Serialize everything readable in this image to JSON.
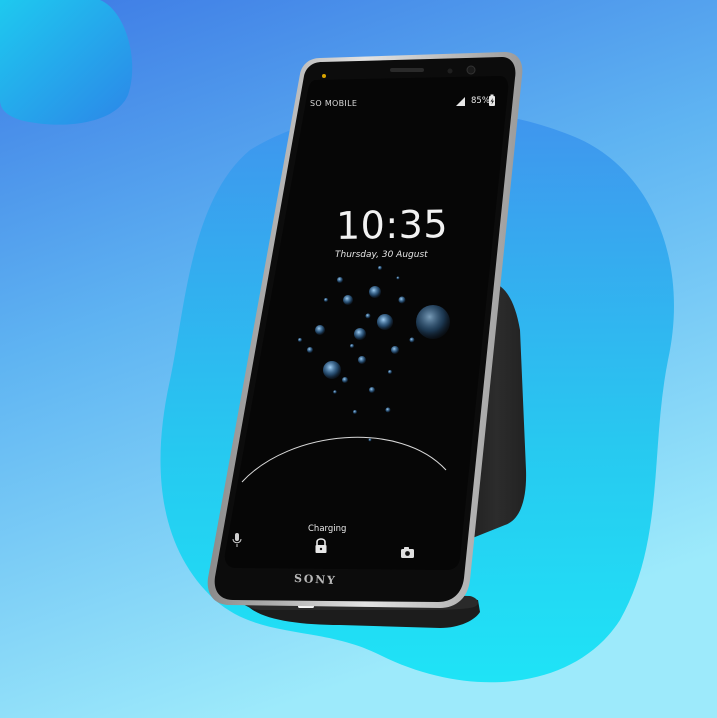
{
  "status_bar": {
    "carrier": "SO MOBILE",
    "battery_text": "85%"
  },
  "lock_screen": {
    "time": "10:35",
    "date": "Thursday, 30 August",
    "charging_label": "Charging"
  },
  "device": {
    "brand": "SONY"
  },
  "icons": {
    "signal": "signal-icon",
    "battery": "battery-charging-icon",
    "microphone": "microphone-icon",
    "lock": "lock-icon",
    "camera": "camera-icon"
  },
  "colors": {
    "background_top": "#3f7fe6",
    "background_bottom": "#97e8fb",
    "blob": "#2ad8f2",
    "phone_screen": "#0a0a0a",
    "dock": "#1e1e1e"
  }
}
